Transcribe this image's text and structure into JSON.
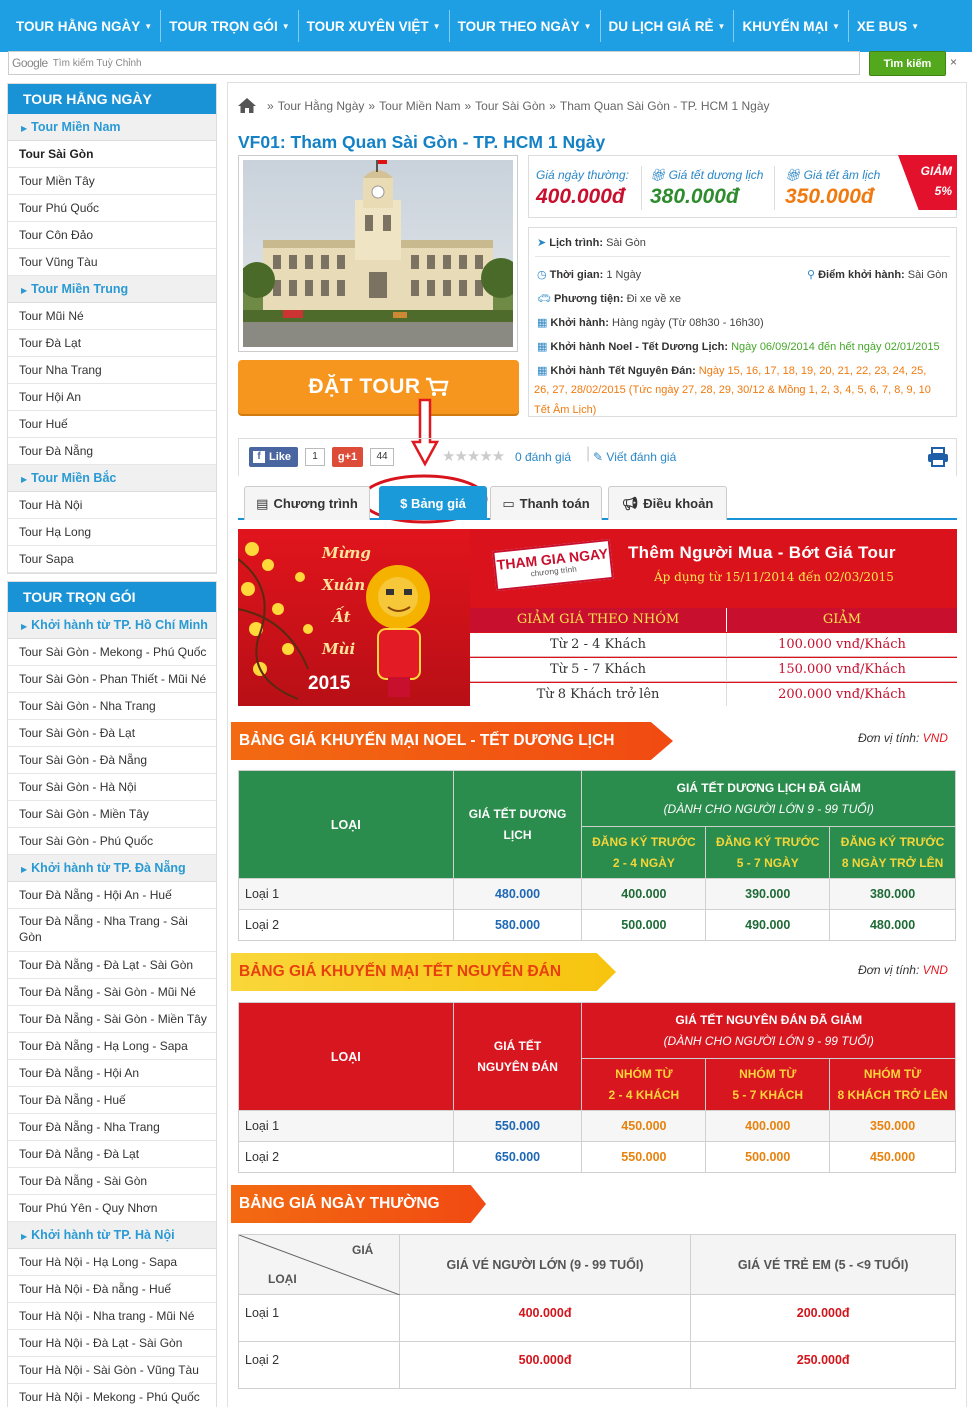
{
  "topnav": [
    "TOUR HẰNG NGÀY",
    "TOUR TRỌN GÓI",
    "TOUR XUYÊN VIỆT",
    "TOUR THEO NGÀY",
    "DU LỊCH GIÁ RẺ",
    "KHUYẾN MẠI",
    "XE BUS"
  ],
  "search": {
    "brand": "Google",
    "placeholder": "Tìm kiếm Tuỳ Chỉnh",
    "button": "Tìm kiếm",
    "close": "×"
  },
  "sidebar1": {
    "title": "TOUR HẰNG NGÀY",
    "g1": "Tour Miền Nam",
    "g1_items": [
      "Tour Sài Gòn",
      "Tour Miền Tây",
      "Tour Phú Quốc",
      "Tour Côn Đảo",
      "Tour Vũng Tàu"
    ],
    "g2": "Tour Miền Trung",
    "g2_items": [
      "Tour Mũi Né",
      "Tour Đà Lạt",
      "Tour Nha Trang",
      "Tour Hội An",
      "Tour Huế",
      "Tour Đà Nẵng"
    ],
    "g3": "Tour Miền Bắc",
    "g3_items": [
      "Tour Hà Nội",
      "Tour Hạ Long",
      "Tour Sapa"
    ]
  },
  "sidebar2": {
    "title": "TOUR TRỌN GÓI",
    "g1": "Khởi hành từ TP. Hồ Chí Minh",
    "g1_items": [
      "Tour Sài Gòn - Mekong - Phú Quốc",
      "Tour Sài Gòn - Phan Thiết - Mũi Né",
      "Tour Sài Gòn - Nha Trang",
      "Tour Sài Gòn - Đà Lạt",
      "Tour Sài Gòn - Đà Nẵng",
      "Tour Sài Gòn - Hà Nội",
      "Tour Sài Gòn - Miền Tây",
      "Tour Sài Gòn - Phú Quốc"
    ],
    "g2": "Khởi hành từ TP. Đà Nẵng",
    "g2_items": [
      "Tour Đà Nẵng - Hội An - Huế",
      "Tour Đà Nẵng - Nha Trang - Sài Gòn",
      "Tour Đà Nẵng - Đà Lạt - Sài Gòn",
      "Tour Đà Nẵng - Sài Gòn - Mũi Né",
      "Tour Đà Nẵng - Sài Gòn - Miền Tây",
      "Tour Đà Nẵng - Hạ Long - Sapa",
      "Tour Đà Nẵng - Hội An",
      "Tour Đà Nẵng - Huế",
      "Tour Đà Nẵng - Nha Trang",
      "Tour Đà Nẵng - Đà Lạt",
      "Tour Đà Nẵng - Sài Gòn",
      "Tour Phú Yên - Quy Nhơn"
    ],
    "g3": "Khởi hành từ TP. Hà Nội",
    "g3_items": [
      "Tour Hà Nội - Hạ Long - Sapa",
      "Tour Hà Nội - Đà nẵng - Huế",
      "Tour Hà Nội - Nha trang - Mũi Né",
      "Tour Hà Nội - Đà Lạt - Sài Gòn",
      "Tour Hà Nội - Sài Gòn - Vũng Tàu",
      "Tour Hà Nội - Mekong - Phú Quốc"
    ]
  },
  "breadcrumb": {
    "sep": "»",
    "items": [
      "Tour Hằng Ngày",
      "Tour Miền Nam",
      "Tour Sài Gòn",
      "Tham Quan Sài Gòn - TP. HCM 1 Ngày"
    ]
  },
  "title": "VF01: Tham Quan Sài Gòn - TP. HCM 1 Ngày",
  "book_label": "ĐẶT TOUR",
  "prices": [
    {
      "label": "Giá ngày thường:",
      "value": "400.000đ",
      "color": "#c8102e"
    },
    {
      "label": "Giá tết dương lịch",
      "value": "380.000đ",
      "color": "#2e8b2e"
    },
    {
      "label": "Giá tết âm lịch",
      "value": "350.000đ",
      "color": "#f07a10"
    }
  ],
  "discount": {
    "line1": "GIẢM",
    "line2": "5%"
  },
  "info": {
    "itinerary_label": "Lịch trình:",
    "itinerary": "Sài Gòn",
    "duration_label": "Thời gian:",
    "duration": "1 Ngày",
    "start_label": "Điểm khởi hành:",
    "start": "Sài Gòn",
    "transport_label": "Phương tiện:",
    "transport": "Đi xe về xe",
    "depart_label": "Khởi hành:",
    "depart": "Hàng ngày (Từ 08h30 - 16h30)",
    "noel_label": "Khởi hành Noel - Tết Dương Lịch:",
    "noel": "Ngày 06/09/2014 đến hết ngày 02/01/2015",
    "tet_label": "Khởi hành Tết Nguyên Đán:",
    "tet_line1": "Ngày 15, 16, 17, 18, 19, 20, 21, 22, 23, 24, 25,",
    "tet_line2": "26, 27, 28/02/2015 (Tức ngày 27, 28, 29, 30/12 & Mồng 1, 2, 3, 4, 5, 6, 7, 8, 9, 10",
    "tet_line3": "Tết Âm Lịch)"
  },
  "social": {
    "like": "Like",
    "like_count": "1",
    "gplus": "+1",
    "gplus_count": "44",
    "reviews": "0 đánh giá",
    "write": "Viết đánh giá"
  },
  "tabs": [
    "Chương trình",
    "$ Bảng giá",
    "Thanh toán",
    "Điều khoản"
  ],
  "banner": {
    "left_words": [
      "Mừng",
      "Xuân",
      "Ất",
      "Mùi",
      "2015"
    ],
    "sticker": "THAM GIA NGAY",
    "sticker_sub": "chương trình",
    "headline": "Thêm Người Mua - Bớt Giá Tour",
    "dates": "Áp dụng từ 15/11/2014 đến 02/03/2015",
    "col1": "GIẢM GIÁ THEO NHÓM",
    "col2": "GIẢM",
    "rows": [
      [
        "Từ 2 - 4 Khách",
        "100.000 vnđ/Khách"
      ],
      [
        "Từ 5 - 7 Khách",
        "150.000 vnđ/Khách"
      ],
      [
        "Từ 8 Khách trở lên",
        "200.000 vnđ/Khách"
      ]
    ]
  },
  "unit": {
    "label": "Đơn vị tính:",
    "currency": "VND"
  },
  "noel_table": {
    "title": "BẢNG GIÁ KHUYẾN MẠI NOEL - TẾT DƯƠNG LỊCH",
    "col_type": "LOẠI",
    "col_price": "GIÁ TẾT DƯƠNG LỊCH",
    "group_title": "GIÁ TẾT DƯƠNG LỊCH ĐÃ GIẢM",
    "group_sub": "(DÀNH CHO NGƯỜI LỚN 9 - 99 TUỔI)",
    "sub_cols": [
      [
        "ĐĂNG KÝ TRƯỚC",
        "2 - 4 NGÀY"
      ],
      [
        "ĐĂNG KÝ TRƯỚC",
        "5 - 7 NGÀY"
      ],
      [
        "ĐĂNG KÝ TRƯỚC",
        "8 NGÀY TRỞ LÊN"
      ]
    ],
    "rows": [
      [
        "Loại 1",
        "480.000",
        "400.000",
        "390.000",
        "380.000"
      ],
      [
        "Loại 2",
        "580.000",
        "500.000",
        "490.000",
        "480.000"
      ]
    ]
  },
  "tet_table": {
    "title": "BẢNG GIÁ KHUYẾN MẠI TẾT NGUYÊN ĐÁN",
    "col_type": "LOẠI",
    "col_price": "GIÁ TẾT NGUYÊN ĐÁN",
    "group_title": "GIÁ TẾT NGUYÊN ĐÁN ĐÃ GIẢM",
    "group_sub": "(DÀNH CHO NGƯỜI LỚN 9 - 99 TUỔI)",
    "sub_cols": [
      [
        "NHÓM TỪ",
        "2 - 4 KHÁCH"
      ],
      [
        "NHÓM TỪ",
        "5 - 7 KHÁCH"
      ],
      [
        "NHÓM TỪ",
        "8 KHÁCH TRỞ LÊN"
      ]
    ],
    "rows": [
      [
        "Loại 1",
        "550.000",
        "450.000",
        "400.000",
        "350.000"
      ],
      [
        "Loại 2",
        "650.000",
        "550.000",
        "500.000",
        "450.000"
      ]
    ]
  },
  "normal_table": {
    "title": "BẢNG GIÁ NGÀY THƯỜNG",
    "corner_top": "GIÁ",
    "corner_bottom": "LOẠI",
    "col_adult": "GIÁ VÉ NGƯỜI LỚN (9 - 99 TUỔI)",
    "col_child": "GIÁ VÉ TRẺ EM (5 - <9 TUỔI)",
    "rows": [
      [
        "Loại 1",
        "400.000đ",
        "200.000đ"
      ],
      [
        "Loại 2",
        "500.000đ",
        "250.000đ"
      ]
    ]
  }
}
